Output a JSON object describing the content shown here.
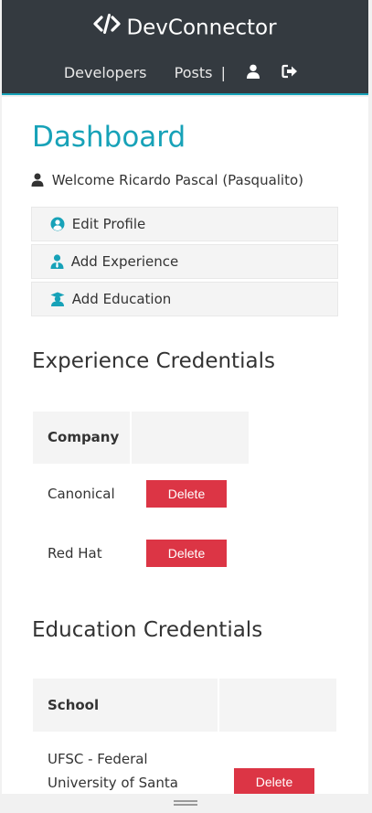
{
  "navbar": {
    "brand": "DevConnector",
    "brand_icon": "code-icon",
    "links": [
      "Developers",
      "Posts"
    ],
    "separator": "|",
    "icons": [
      "user-icon",
      "sign-out-icon"
    ],
    "accent_color": "#17a2b8",
    "background_color": "#343a40"
  },
  "dashboard": {
    "title": "Dashboard",
    "welcome": "Welcome Ricardo Pascal (Pasqualito)",
    "buttons": [
      {
        "label": "Edit Profile",
        "icon": "user-circle-icon"
      },
      {
        "label": "Add Experience",
        "icon": "user-tie-icon"
      },
      {
        "label": "Add Education",
        "icon": "graduation-cap-icon"
      }
    ]
  },
  "experience": {
    "heading": "Experience Credentials",
    "column": "Company",
    "rows": [
      {
        "company": "Canonical",
        "delete_label": "Delete"
      },
      {
        "company": "Red Hat",
        "delete_label": "Delete"
      }
    ]
  },
  "education": {
    "heading": "Education Credentials",
    "column": "School",
    "rows": [
      {
        "school": "UFSC - Federal University of Santa",
        "delete_label": "Delete"
      }
    ]
  },
  "colors": {
    "primary": "#17a2b8",
    "danger": "#dc3545",
    "light": "#f4f4f4"
  }
}
